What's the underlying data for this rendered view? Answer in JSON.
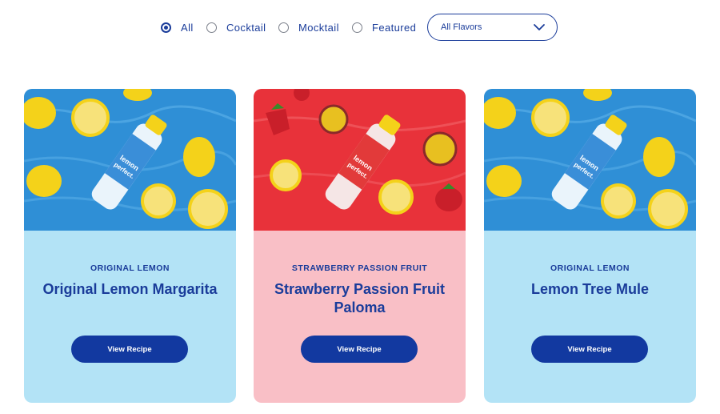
{
  "filters": {
    "options": [
      {
        "label": "All",
        "checked": true
      },
      {
        "label": "Cocktail",
        "checked": false
      },
      {
        "label": "Mocktail",
        "checked": false
      },
      {
        "label": "Featured",
        "checked": false
      }
    ],
    "flavor_select": {
      "value": "All Flavors",
      "icon": "chevron-down-icon"
    }
  },
  "cards": [
    {
      "flavor": "ORIGINAL LEMON",
      "title": "Original Lemon Margarita",
      "button_label": "View Recipe",
      "photo_background": "#2f8fd6",
      "card_color": "#b3e3f6",
      "bottle_brand": "lemon perfect."
    },
    {
      "flavor": "STRAWBERRY PASSION FRUIT",
      "title": "Strawberry Passion Fruit Paloma",
      "button_label": "View Recipe",
      "photo_background": "#e8323a",
      "card_color": "#f9bfc6",
      "bottle_brand": "lemon perfect."
    },
    {
      "flavor": "ORIGINAL LEMON",
      "title": "Lemon Tree Mule",
      "button_label": "View Recipe",
      "photo_background": "#2f8fd6",
      "card_color": "#b3e3f6",
      "bottle_brand": "lemon perfect."
    }
  ],
  "colors": {
    "brand_blue": "#1a3c9a",
    "button_blue": "#1239a0",
    "lemon_yellow": "#f4d21a"
  }
}
